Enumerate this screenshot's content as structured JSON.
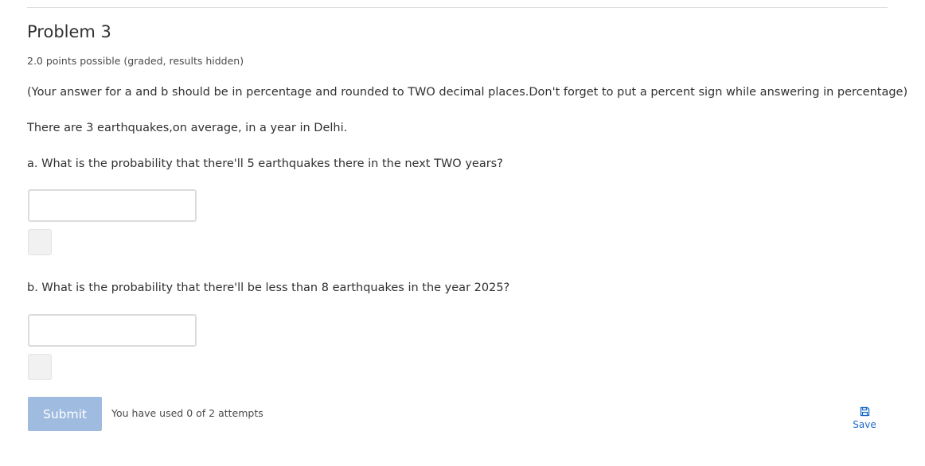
{
  "problem": {
    "title": "Problem 3",
    "points": "2.0 points possible (graded, results hidden)",
    "instructions": "(Your answer for a and b should be in percentage and rounded to TWO decimal places.Don't forget to put a percent sign while answering in percentage)",
    "context": "There are 3 earthquakes,on average, in a year in Delhi.",
    "question_a": "a. What is the probability that there'll 5 earthquakes there in the next TWO years?",
    "answer_a_value": "",
    "question_b": "b. What is the probability that there'll be less than 8 earthquakes in the year 2025?",
    "answer_b_value": ""
  },
  "actions": {
    "submit_label": "Submit",
    "attempts_text": "You have used 0 of 2 attempts",
    "save_label": "Save",
    "save_icon": "floppy-disk-icon"
  },
  "colors": {
    "submit_bg": "#9fbbe0",
    "link": "#1b6ac9",
    "text": "#313131"
  }
}
